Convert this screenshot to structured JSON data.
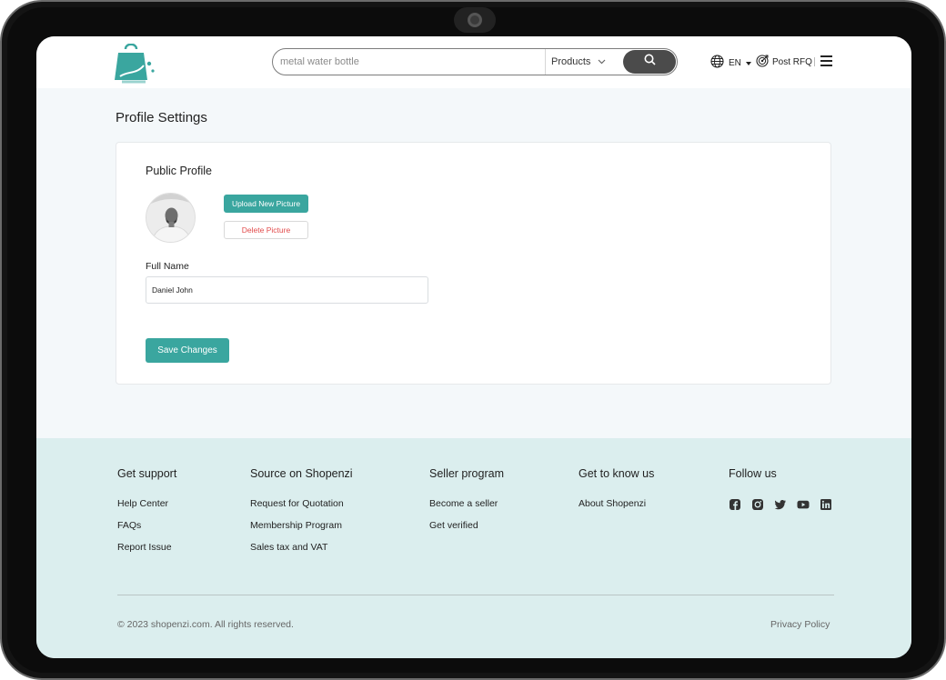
{
  "header": {
    "search_placeholder": "metal water bottle",
    "category": "Products",
    "language": "EN",
    "post_rfq": "Post RFQ"
  },
  "main": {
    "page_title": "Profile Settings",
    "section_title": "Public Profile",
    "upload_label": "Upload New Picture",
    "delete_label": "Delete Picture",
    "full_name_label": "Full Name",
    "full_name_value": "Daniel John",
    "save_label": "Save Changes"
  },
  "footer": {
    "columns": [
      {
        "title": "Get support",
        "links": [
          "Help Center",
          "FAQs",
          "Report Issue"
        ]
      },
      {
        "title": "Source on Shopenzi",
        "links": [
          "Request for Quotation",
          "Membership Program",
          "Sales tax and VAT"
        ]
      },
      {
        "title": "Seller program",
        "links": [
          "Become a seller",
          "Get verified"
        ]
      },
      {
        "title": "Get to know us",
        "links": [
          "About Shopenzi"
        ]
      },
      {
        "title": "Follow us",
        "social": [
          "facebook-icon",
          "instagram-icon",
          "twitter-icon",
          "youtube-icon",
          "linkedin-icon"
        ]
      }
    ],
    "copyright": "© 2023 shopenzi.com. All rights reserved.",
    "privacy": "Privacy Policy"
  },
  "colors": {
    "accent": "#3aa69f",
    "danger": "#e24b4b",
    "footer_bg": "#dbeeee",
    "page_bg": "#f4f8fa"
  }
}
